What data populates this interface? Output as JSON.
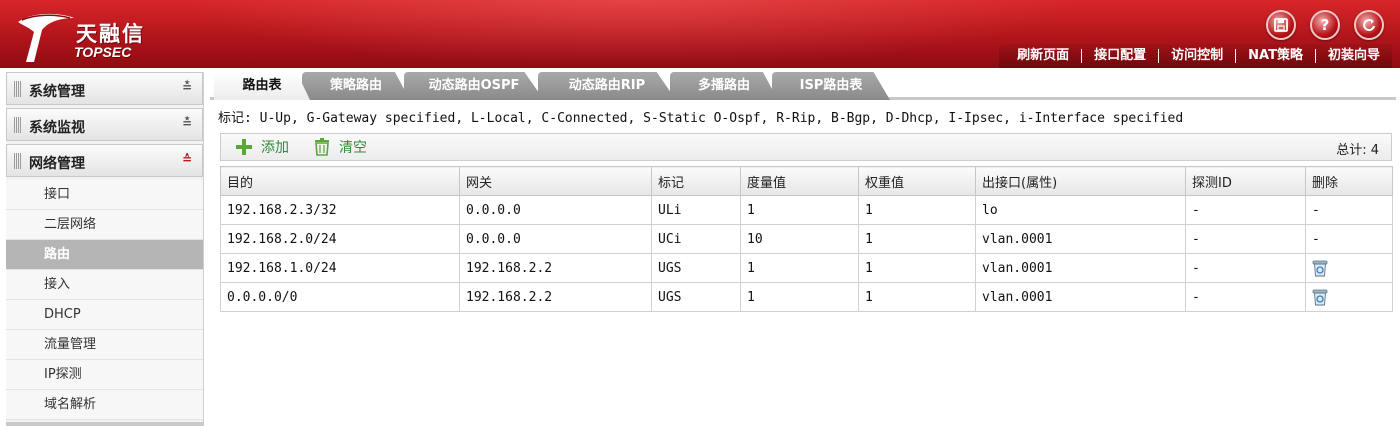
{
  "header": {
    "logo_cn": "天融信",
    "logo_en": "TOPSEC",
    "icons": [
      "save-icon",
      "help-icon",
      "logout-icon"
    ],
    "nav": [
      "刷新页面",
      "接口配置",
      "访问控制",
      "NAT策略",
      "初装向导"
    ]
  },
  "sidebar": {
    "sections": [
      {
        "label": "系统管理",
        "state": "collapsed"
      },
      {
        "label": "系统监视",
        "state": "collapsed"
      },
      {
        "label": "网络管理",
        "state": "expanded"
      }
    ],
    "items": [
      "接口",
      "二层网络",
      "路由",
      "接入",
      "DHCP",
      "流量管理",
      "IP探测",
      "域名解析"
    ],
    "active_item": "路由"
  },
  "tabs": [
    "路由表",
    "策略路由",
    "动态路由OSPF",
    "动态路由RIP",
    "多播路由",
    "ISP路由表"
  ],
  "active_tab": "路由表",
  "legend": "标记: U-Up, G-Gateway specified, L-Local, C-Connected, S-Static O-Ospf, R-Rip, B-Bgp, D-Dhcp, I-Ipsec, i-Interface specified",
  "toolbar": {
    "add_label": "添加",
    "clear_label": "清空",
    "total": "总计: 4"
  },
  "table": {
    "columns": [
      "目的",
      "网关",
      "标记",
      "度量值",
      "权重值",
      "出接口(属性)",
      "探测ID",
      "删除"
    ],
    "rows": [
      [
        "192.168.2.3/32",
        "0.0.0.0",
        "ULi",
        "1",
        "1",
        "lo",
        "-",
        "-"
      ],
      [
        "192.168.2.0/24",
        "0.0.0.0",
        "UCi",
        "10",
        "1",
        "vlan.0001",
        "-",
        "-"
      ],
      [
        "192.168.1.0/24",
        "192.168.2.2",
        "UGS",
        "1",
        "1",
        "vlan.0001",
        "-",
        "delete-icon"
      ],
      [
        "0.0.0.0/0",
        "192.168.2.2",
        "UGS",
        "1",
        "1",
        "vlan.0001",
        "-",
        "delete-icon"
      ]
    ]
  },
  "colors": {
    "header_red": "#b1151b",
    "action_green": "#2e8b3a",
    "active_item_bg": "#b5b5b5"
  }
}
